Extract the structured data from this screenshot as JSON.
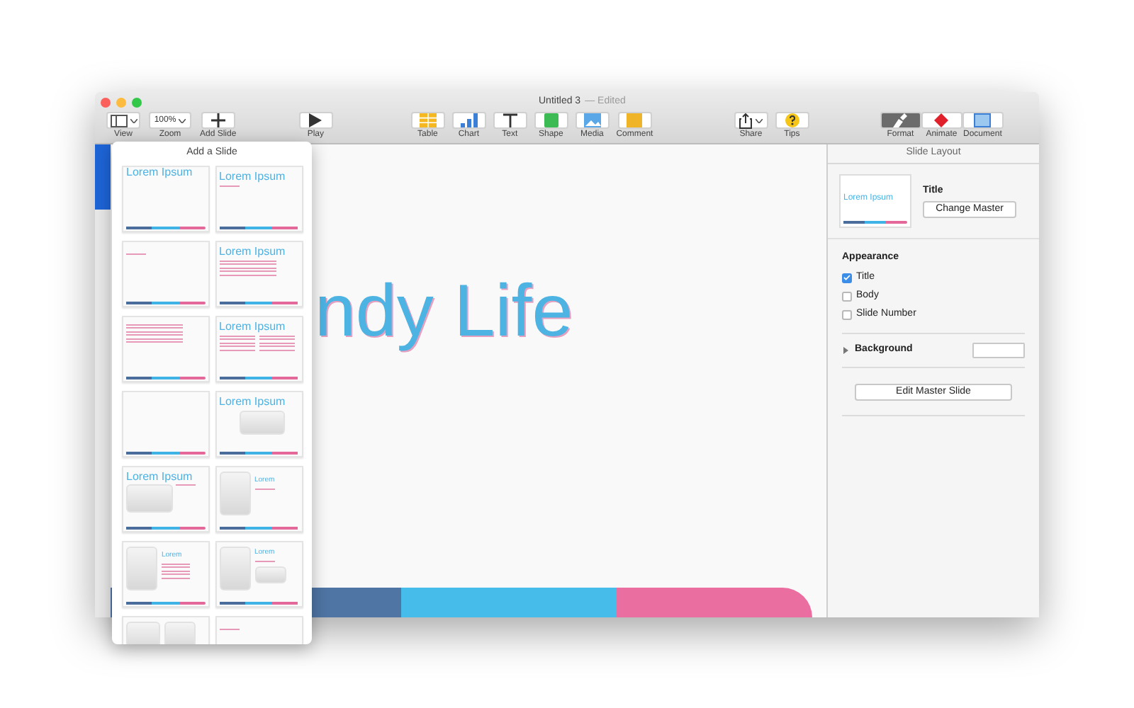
{
  "window": {
    "title": "Untitled 3",
    "status": "— Edited"
  },
  "toolbar": [
    {
      "label": "View",
      "kind": "view",
      "selected": false
    },
    {
      "label": "Zoom",
      "kind": "zoom",
      "value": "100%",
      "selected": false
    },
    {
      "label": "Add Slide",
      "kind": "plus",
      "selected": false
    },
    {
      "label": "Play",
      "kind": "play",
      "selected": false
    },
    {
      "label": "Table",
      "kind": "table",
      "selected": false
    },
    {
      "label": "Chart",
      "kind": "chart",
      "selected": false
    },
    {
      "label": "Text",
      "kind": "text",
      "selected": false
    },
    {
      "label": "Shape",
      "kind": "shape",
      "selected": false
    },
    {
      "label": "Media",
      "kind": "media",
      "selected": false
    },
    {
      "label": "Comment",
      "kind": "comment",
      "selected": false
    },
    {
      "label": "Share",
      "kind": "share",
      "selected": false
    },
    {
      "label": "Tips",
      "kind": "tips",
      "selected": false
    },
    {
      "label": "Format",
      "kind": "format",
      "selected": true
    },
    {
      "label": "Animate",
      "kind": "animate",
      "selected": false
    },
    {
      "label": "Document",
      "kind": "document",
      "selected": false
    }
  ],
  "popover": {
    "title": "Add a Slide",
    "layouts": [
      {
        "kind": "title",
        "title": "Lorem Ipsum"
      },
      {
        "kind": "title-subtitle",
        "title": "Lorem Ipsum"
      },
      {
        "kind": "subtitle"
      },
      {
        "kind": "title-bullets",
        "title": "Lorem Ipsum"
      },
      {
        "kind": "bullets"
      },
      {
        "kind": "title-columns",
        "title": "Lorem Ipsum"
      },
      {
        "kind": "blank"
      },
      {
        "kind": "title-photo",
        "title": "Lorem Ipsum"
      },
      {
        "kind": "title-photo-subtitle",
        "title": "Lorem Ipsum"
      },
      {
        "kind": "photo-title",
        "title": "Lorem"
      },
      {
        "kind": "photo-title-bullets",
        "title": "Lorem"
      },
      {
        "kind": "photo-title-photo",
        "title": "Lorem"
      },
      {
        "kind": "photos"
      },
      {
        "kind": "subtitle"
      }
    ]
  },
  "slide": {
    "title": "ndy Life"
  },
  "inspector": {
    "header": "Slide Layout",
    "thumbnail_title": "Lorem Ipsum",
    "master_name": "Title",
    "change_button": "Change Master",
    "appearance_heading": "Appearance",
    "options": [
      {
        "label": "Title",
        "checked": true
      },
      {
        "label": "Body",
        "checked": false
      },
      {
        "label": "Slide Number",
        "checked": false
      }
    ],
    "background": {
      "label": "Background",
      "expanded": false
    },
    "edit_button": "Edit Master Slide"
  }
}
